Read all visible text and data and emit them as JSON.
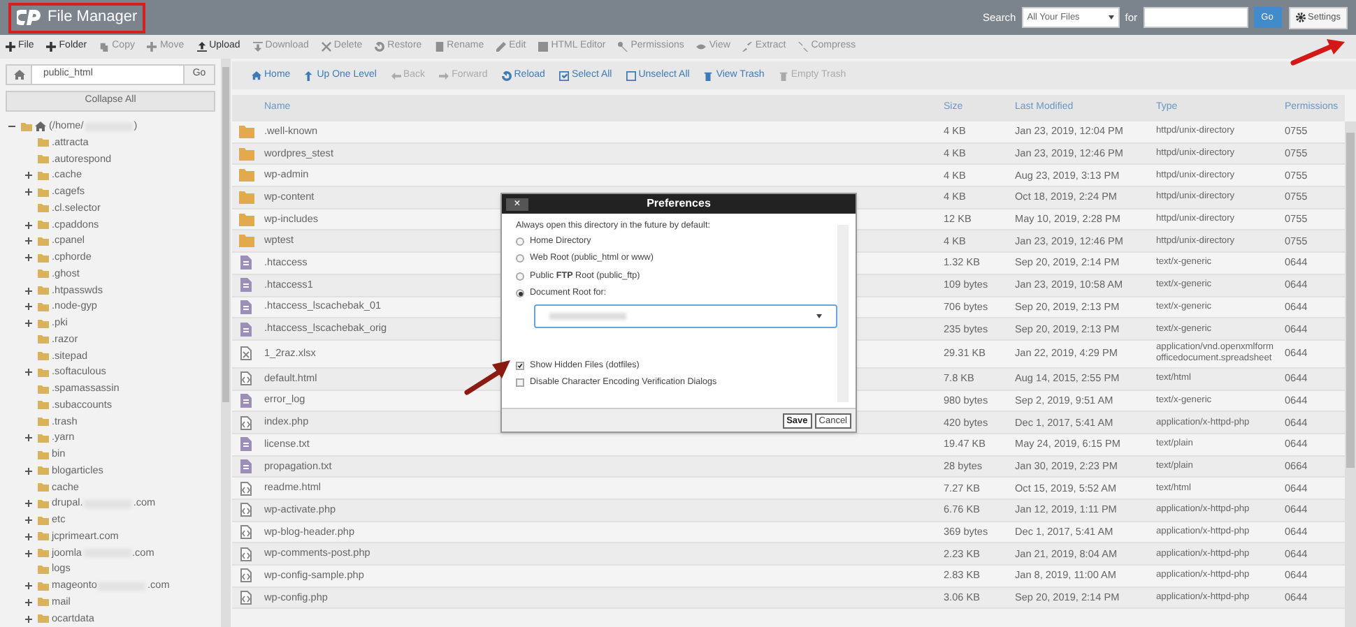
{
  "header": {
    "title": "File Manager",
    "search_label": "Search",
    "scope": "All Your Files",
    "for_label": "for",
    "go": "Go",
    "settings": "Settings"
  },
  "toolbar": [
    {
      "label": "File",
      "disabled": false
    },
    {
      "label": "Folder",
      "disabled": false
    },
    {
      "label": "Copy",
      "disabled": true
    },
    {
      "label": "Move",
      "disabled": true
    },
    {
      "label": "Upload",
      "disabled": false
    },
    {
      "label": "Download",
      "disabled": true
    },
    {
      "label": "Delete",
      "disabled": true
    },
    {
      "label": "Restore",
      "disabled": true
    },
    {
      "label": "Rename",
      "disabled": true
    },
    {
      "label": "Edit",
      "disabled": true
    },
    {
      "label": "HTML Editor",
      "disabled": true
    },
    {
      "label": "Permissions",
      "disabled": true
    },
    {
      "label": "View",
      "disabled": true
    },
    {
      "label": "Extract",
      "disabled": true
    },
    {
      "label": "Compress",
      "disabled": true
    }
  ],
  "sidebar": {
    "path": "public_html",
    "go": "Go",
    "collapse": "Collapse All",
    "tree": {
      "label": "(/home/",
      "label_end": ")",
      "kind": "expanded",
      "children": [
        {
          "label": ".attracta",
          "kind": "leaf"
        },
        {
          "label": ".autorespond",
          "kind": "leaf"
        },
        {
          "label": ".cache",
          "kind": "collapsed"
        },
        {
          "label": ".cagefs",
          "kind": "collapsed"
        },
        {
          "label": ".cl.selector",
          "kind": "leaf"
        },
        {
          "label": ".cpaddons",
          "kind": "collapsed"
        },
        {
          "label": ".cpanel",
          "kind": "collapsed"
        },
        {
          "label": ".cphorde",
          "kind": "collapsed"
        },
        {
          "label": ".ghost",
          "kind": "leaf"
        },
        {
          "label": ".htpasswds",
          "kind": "collapsed"
        },
        {
          "label": ".node-gyp",
          "kind": "collapsed"
        },
        {
          "label": ".pki",
          "kind": "collapsed"
        },
        {
          "label": ".razor",
          "kind": "leaf"
        },
        {
          "label": ".sitepad",
          "kind": "leaf"
        },
        {
          "label": ".softaculous",
          "kind": "collapsed"
        },
        {
          "label": ".spamassassin",
          "kind": "leaf"
        },
        {
          "label": ".subaccounts",
          "kind": "leaf"
        },
        {
          "label": ".trash",
          "kind": "leaf"
        },
        {
          "label": ".yarn",
          "kind": "collapsed"
        },
        {
          "label": "bin",
          "kind": "leaf"
        },
        {
          "label": "blogarticles",
          "kind": "collapsed"
        },
        {
          "label": "cache",
          "kind": "leaf"
        },
        {
          "label": "drupal.",
          "label_end": ".com",
          "kind": "collapsed"
        },
        {
          "label": "etc",
          "kind": "collapsed"
        },
        {
          "label": "jcprimeart.com",
          "kind": "collapsed"
        },
        {
          "label": "joomla",
          "label_end": ".com",
          "kind": "collapsed"
        },
        {
          "label": "logs",
          "kind": "leaf"
        },
        {
          "label": "mageonto",
          "label_end": ".com",
          "kind": "collapsed"
        },
        {
          "label": "mail",
          "kind": "collapsed"
        },
        {
          "label": "ocartdata",
          "kind": "collapsed"
        }
      ]
    }
  },
  "nav": [
    {
      "label": "Home",
      "disabled": false
    },
    {
      "label": "Up One Level",
      "disabled": false
    },
    {
      "label": "Back",
      "disabled": true
    },
    {
      "label": "Forward",
      "disabled": true
    },
    {
      "label": "Reload",
      "disabled": false
    },
    {
      "label": "Select All",
      "disabled": false
    },
    {
      "label": "Unselect All",
      "disabled": false
    },
    {
      "label": "View Trash",
      "disabled": false
    },
    {
      "label": "Empty Trash",
      "disabled": true
    }
  ],
  "table": {
    "columns": [
      "Name",
      "Size",
      "Last Modified",
      "Type",
      "Permissions"
    ],
    "rows": [
      {
        "kind": "folder",
        "name": ".well-known",
        "size": "4 KB",
        "modified": "Jan 23, 2019, 12:04 PM",
        "type": "httpd/unix-directory",
        "permissions": "0755"
      },
      {
        "kind": "folder",
        "name": "wordpres_stest",
        "size": "4 KB",
        "modified": "Jan 23, 2019, 12:46 PM",
        "type": "httpd/unix-directory",
        "permissions": "0755"
      },
      {
        "kind": "folder",
        "name": "wp-admin",
        "size": "4 KB",
        "modified": "Aug 23, 2019, 3:13 PM",
        "type": "httpd/unix-directory",
        "permissions": "0755"
      },
      {
        "kind": "folder",
        "name": "wp-content",
        "size": "4 KB",
        "modified": "Oct 18, 2019, 2:24 PM",
        "type": "httpd/unix-directory",
        "permissions": "0755"
      },
      {
        "kind": "folder",
        "name": "wp-includes",
        "size": "12 KB",
        "modified": "May 10, 2019, 2:28 PM",
        "type": "httpd/unix-directory",
        "permissions": "0755"
      },
      {
        "kind": "folder",
        "name": "wptest",
        "size": "4 KB",
        "modified": "Jan 23, 2019, 12:46 PM",
        "type": "httpd/unix-directory",
        "permissions": "0755"
      },
      {
        "kind": "text",
        "name": ".htaccess",
        "size": "1.32 KB",
        "modified": "Sep 20, 2019, 2:14 PM",
        "type": "text/x-generic",
        "permissions": "0644"
      },
      {
        "kind": "text",
        "name": ".htaccess1",
        "size": "109 bytes",
        "modified": "Jan 23, 2019, 10:58 AM",
        "type": "text/x-generic",
        "permissions": "0644"
      },
      {
        "kind": "text",
        "name": ".htaccess_lscachebak_01",
        "size": "706 bytes",
        "modified": "Sep 20, 2019, 2:13 PM",
        "type": "text/x-generic",
        "permissions": "0644"
      },
      {
        "kind": "text",
        "name": ".htaccess_lscachebak_orig",
        "size": "235 bytes",
        "modified": "Sep 20, 2019, 2:13 PM",
        "type": "text/x-generic",
        "permissions": "0644"
      },
      {
        "kind": "sheet",
        "name": "1_2raz.xlsx",
        "size": "29.31 KB",
        "modified": "Jan 22, 2019, 4:29 PM",
        "type": "application/vnd.openxmlform officedocument.spreadsheet",
        "permissions": "0644"
      },
      {
        "kind": "code",
        "name": "default.html",
        "size": "7.8 KB",
        "modified": "Aug 14, 2015, 2:55 PM",
        "type": "text/html",
        "permissions": "0644"
      },
      {
        "kind": "text",
        "name": "error_log",
        "size": "980 bytes",
        "modified": "Sep 2, 2019, 9:51 AM",
        "type": "text/x-generic",
        "permissions": "0644"
      },
      {
        "kind": "code",
        "name": "index.php",
        "size": "420 bytes",
        "modified": "Dec 1, 2017, 5:41 AM",
        "type": "application/x-httpd-php",
        "permissions": "0644"
      },
      {
        "kind": "text",
        "name": "license.txt",
        "size": "19.47 KB",
        "modified": "May 24, 2019, 6:15 PM",
        "type": "text/plain",
        "permissions": "0644"
      },
      {
        "kind": "text",
        "name": "propagation.txt",
        "size": "28 bytes",
        "modified": "Jan 30, 2019, 2:23 PM",
        "type": "text/plain",
        "permissions": "0664"
      },
      {
        "kind": "code",
        "name": "readme.html",
        "size": "7.27 KB",
        "modified": "Oct 15, 2019, 5:52 AM",
        "type": "text/html",
        "permissions": "0644"
      },
      {
        "kind": "code",
        "name": "wp-activate.php",
        "size": "6.76 KB",
        "modified": "Jan 12, 2019, 1:11 PM",
        "type": "application/x-httpd-php",
        "permissions": "0644"
      },
      {
        "kind": "code",
        "name": "wp-blog-header.php",
        "size": "369 bytes",
        "modified": "Dec 1, 2017, 5:41 AM",
        "type": "application/x-httpd-php",
        "permissions": "0644"
      },
      {
        "kind": "code",
        "name": "wp-comments-post.php",
        "size": "2.23 KB",
        "modified": "Jan 21, 2019, 8:04 AM",
        "type": "application/x-httpd-php",
        "permissions": "0644"
      },
      {
        "kind": "code",
        "name": "wp-config-sample.php",
        "size": "2.83 KB",
        "modified": "Jan 8, 2019, 11:00 AM",
        "type": "application/x-httpd-php",
        "permissions": "0644"
      },
      {
        "kind": "code",
        "name": "wp-config.php",
        "size": "3.06 KB",
        "modified": "Sep 20, 2019, 2:14 PM",
        "type": "application/x-httpd-php",
        "permissions": "0644"
      }
    ]
  },
  "dialog": {
    "title": "Preferences",
    "close": "×",
    "intro": "Always open this directory in the future by default:",
    "radios": [
      {
        "label": "Home Directory",
        "selected": false
      },
      {
        "label": "Web Root (public_html or www)",
        "selected": false
      },
      {
        "label": "Public **FTP** Root (public_ftp)",
        "selected": false
      },
      {
        "label": "Document Root for:",
        "selected": true
      }
    ],
    "checkboxes": [
      {
        "label": "Show Hidden Files (dotfiles)",
        "checked": true
      },
      {
        "label": "Disable Character Encoding Verification Dialogs",
        "checked": false
      }
    ],
    "buttons": [
      "Save",
      "Cancel"
    ]
  }
}
